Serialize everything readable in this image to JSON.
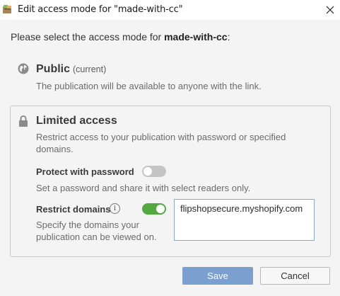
{
  "window": {
    "title": "Edit access mode for \"made-with-cc\"",
    "icons": {
      "app": "app-icon",
      "close": "close-icon"
    }
  },
  "prompt": {
    "prefix": "Please select the access mode for ",
    "name": "made-with-cc",
    "suffix": ":"
  },
  "public_option": {
    "icon": "globe-icon",
    "title": "Public",
    "subtitle": "(current)",
    "description": "The publication will be available to anyone with the link."
  },
  "limited_option": {
    "icon": "lock-icon",
    "title": "Limited access",
    "description_line1": "Restrict access to your publication with password or specified",
    "description_line2": "domains.",
    "password": {
      "label": "Protect with password",
      "enabled": false,
      "description": "Set a password and share it with select readers only."
    },
    "domains": {
      "label": "Restrict domains",
      "info_icon": "info-icon",
      "enabled": true,
      "description_line1": "Specify the domains your",
      "description_line2": "publication can be viewed on.",
      "value": "flipshopsecure.myshopify.com"
    }
  },
  "buttons": {
    "save": "Save",
    "cancel": "Cancel"
  },
  "colors": {
    "toggle_on": "#53a93f",
    "toggle_off": "#c4c4c4",
    "save_button": "#7b9fcf",
    "dialog_bg": "#f4f4f4"
  }
}
